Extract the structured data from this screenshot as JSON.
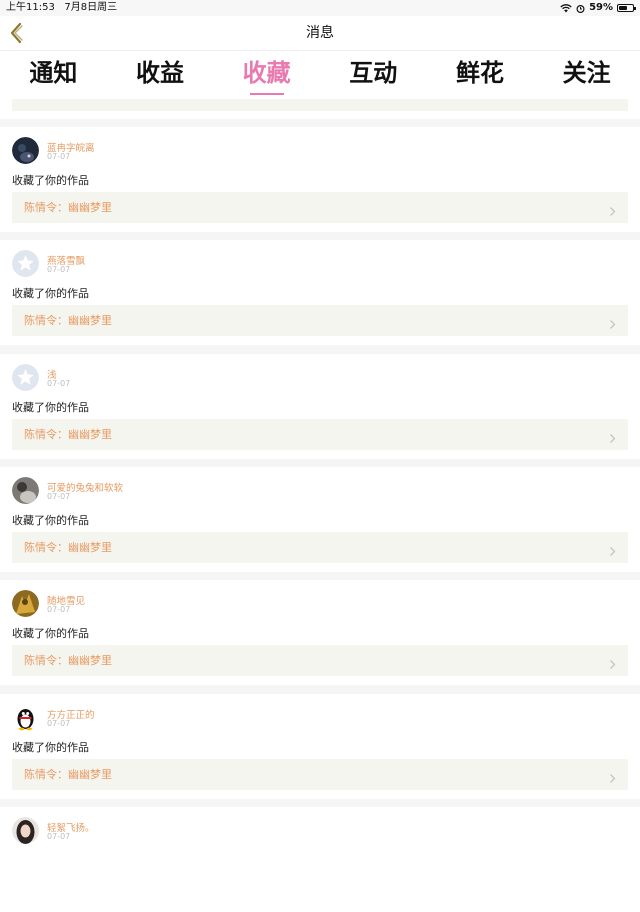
{
  "status_bar": {
    "time": "上午11:53",
    "date": "7月8日周三",
    "battery": "59%",
    "battery_level": 0.59
  },
  "nav": {
    "title": "消息",
    "back_icon": "chevron-left-icon"
  },
  "tabs": [
    {
      "label": "通知",
      "active": false
    },
    {
      "label": "收益",
      "active": false
    },
    {
      "label": "收藏",
      "active": true
    },
    {
      "label": "互动",
      "active": false
    },
    {
      "label": "鲜花",
      "active": false
    },
    {
      "label": "关注",
      "active": false
    }
  ],
  "colors": {
    "accent": "#e97ab0",
    "name": "#e79b62",
    "work_bg": "#f5f5ef"
  },
  "items": [
    {
      "user": "蓝冉字皖离",
      "date": "07-07",
      "action": "收藏了你的作品",
      "work": "陈情令：幽幽梦里",
      "avatar": "photo-dark"
    },
    {
      "user": "燕落雪飘",
      "date": "07-07",
      "action": "收藏了你的作品",
      "work": "陈情令：幽幽梦里",
      "avatar": "default-star"
    },
    {
      "user": "浅",
      "date": "07-07",
      "action": "收藏了你的作品",
      "work": "陈情令：幽幽梦里",
      "avatar": "default-star"
    },
    {
      "user": "可爱的兔兔和软软",
      "date": "07-07",
      "action": "收藏了你的作品",
      "work": "陈情令：幽幽梦里",
      "avatar": "photo-gray"
    },
    {
      "user": "随地雪见",
      "date": "07-07",
      "action": "收藏了你的作品",
      "work": "陈情令：幽幽梦里",
      "avatar": "photo-gold"
    },
    {
      "user": "方方正正的",
      "date": "07-07",
      "action": "收藏了你的作品",
      "work": "陈情令：幽幽梦里",
      "avatar": "penguin"
    },
    {
      "user": "轻絮飞扬。",
      "date": "07-07",
      "action": "",
      "work": "",
      "avatar": "photo-girl"
    }
  ]
}
